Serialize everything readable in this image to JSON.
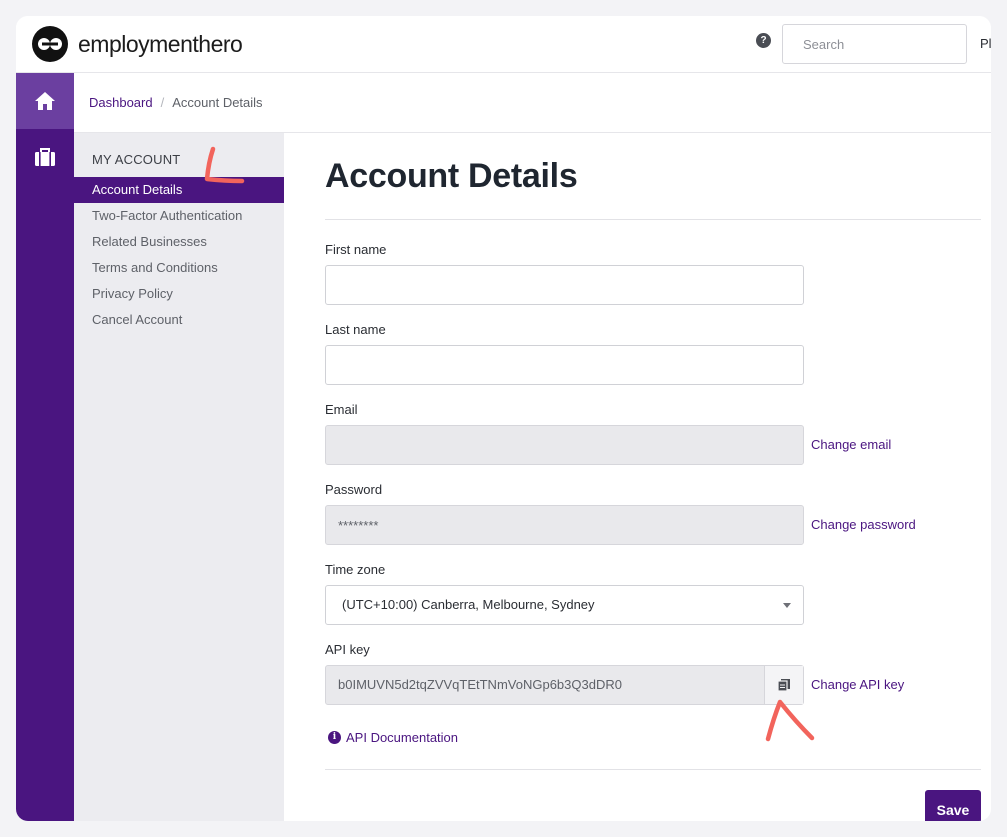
{
  "brand": {
    "name": "employmenthero"
  },
  "header": {
    "help_icon": "question-circle-icon",
    "help_glyph": "?",
    "search_placeholder": "Search",
    "user_truncated": "Pl"
  },
  "rail": {
    "items": [
      {
        "icon": "home-icon",
        "active": true
      },
      {
        "icon": "briefcase-icon",
        "active": false
      }
    ]
  },
  "breadcrumb": {
    "link": "Dashboard",
    "separator": "/",
    "current": "Account Details"
  },
  "menu": {
    "heading": "MY ACCOUNT",
    "items": [
      {
        "label": "Account Details",
        "active": true
      },
      {
        "label": "Two-Factor Authentication",
        "active": false
      },
      {
        "label": "Related Businesses",
        "active": false
      },
      {
        "label": "Terms and Conditions",
        "active": false
      },
      {
        "label": "Privacy Policy",
        "active": false
      },
      {
        "label": "Cancel Account",
        "active": false
      }
    ]
  },
  "form": {
    "title": "Account Details",
    "first_name": {
      "label": "First name",
      "value": ""
    },
    "last_name": {
      "label": "Last name",
      "value": ""
    },
    "email": {
      "label": "Email",
      "value": "",
      "action": "Change email"
    },
    "password": {
      "label": "Password",
      "value": "********",
      "action": "Change password"
    },
    "timezone": {
      "label": "Time zone",
      "value": "(UTC+10:00) Canberra, Melbourne, Sydney"
    },
    "api_key": {
      "label": "API key",
      "value": "b0IMUVN5d2tqZVVqTEtTNmVoNGp6b3Q3dDR0",
      "action": "Change API key",
      "copy_icon": "copy-icon"
    },
    "api_doc": {
      "label": "API Documentation",
      "icon": "info-icon",
      "glyph": "i"
    },
    "save_label": "Save"
  },
  "colors": {
    "brand_purple": "#4a1580",
    "active_rail": "#6b3fa0",
    "annotation": "#f2645c"
  }
}
